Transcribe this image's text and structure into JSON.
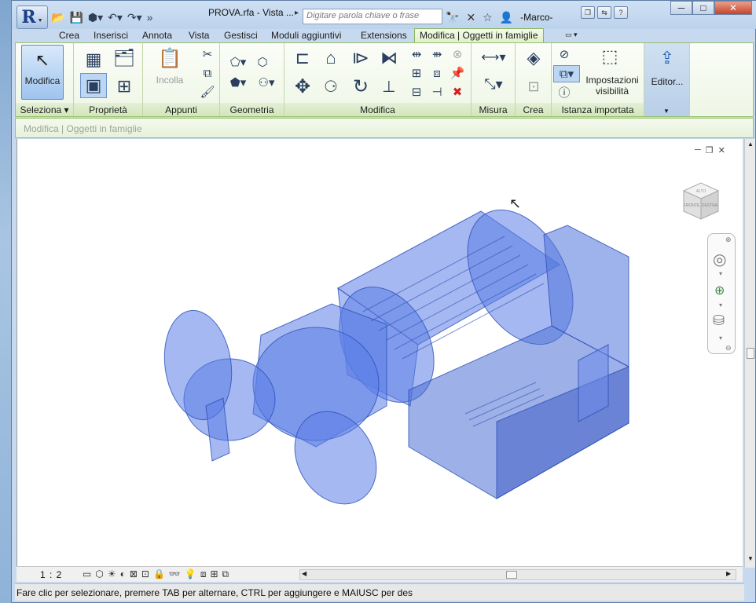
{
  "window": {
    "doc_title": "PROVA.rfa - Vista ...",
    "search_placeholder": "Digitare parola chiave o frase",
    "user": "-Marco-"
  },
  "tabs": [
    {
      "label": "Crea"
    },
    {
      "label": "Inserisci"
    },
    {
      "label": "Annota"
    },
    {
      "label": "Vista"
    },
    {
      "label": "Gestisci"
    },
    {
      "label": "Moduli aggiuntivi"
    },
    {
      "label": "Extensions"
    },
    {
      "label": "Modifica | Oggetti in famiglie",
      "active": true
    }
  ],
  "ribbon": {
    "modifica_label": "Modifica",
    "incolla_label": "Incolla",
    "impostazioni_label": "Impostazioni visibilità",
    "impostazioni_line1": "Impostazioni",
    "impostazioni_line2": "visibilità",
    "editor_label": "Editor...",
    "panels": [
      {
        "label": "Seleziona ▾"
      },
      {
        "label": "Proprietà"
      },
      {
        "label": "Appunti"
      },
      {
        "label": "Geometria"
      },
      {
        "label": "Modifica"
      },
      {
        "label": "Misura"
      },
      {
        "label": "Crea"
      },
      {
        "label": "Istanza importata"
      }
    ]
  },
  "optbar": {
    "context": "Modifica | Oggetti in famiglie"
  },
  "viewbar": {
    "scale": "1 : 2"
  },
  "status": {
    "text": "Fare clic per selezionare, premere TAB per alternare, CTRL per aggiungere e MAIUSC per des"
  },
  "viewcube": {
    "face_front": "FRONTE",
    "face_right": "DESTRA",
    "face_top": "ALTO"
  },
  "colors": {
    "model_fill": "#5b7ee6",
    "model_stroke": "#2c4fb8",
    "ribbon_green": "#9ac070"
  }
}
